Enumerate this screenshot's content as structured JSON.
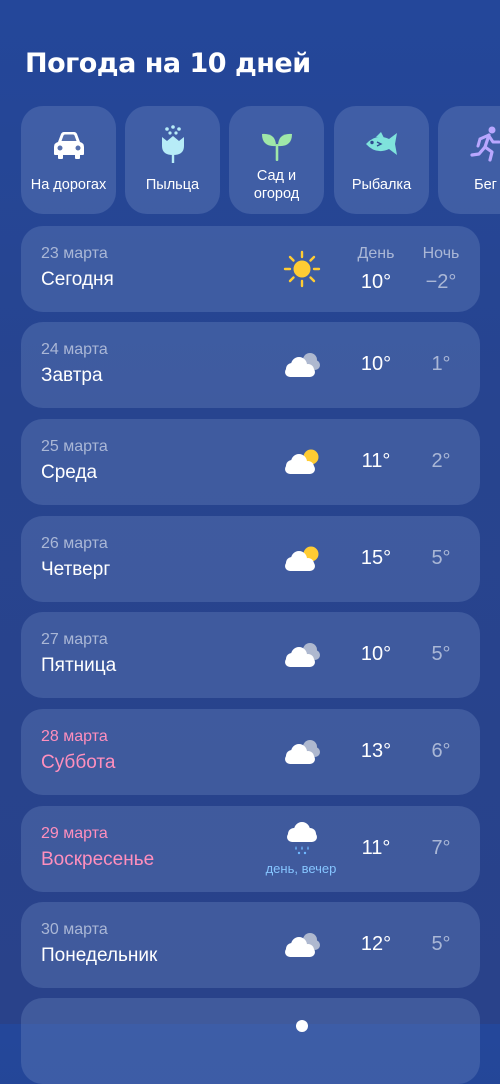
{
  "page_title": "Погода на 10 дней",
  "categories": [
    {
      "label": "На дорогах",
      "icon": "car-icon",
      "color": "#ffffff"
    },
    {
      "label": "Пыльца",
      "icon": "flower-icon",
      "color": "#b7ecf7"
    },
    {
      "label": "Сад и\nогород",
      "icon": "sprout-icon",
      "color": "#9fe7a8"
    },
    {
      "label": "Рыбалка",
      "icon": "fish-icon",
      "color": "#7fe3dc"
    },
    {
      "label": "Бег",
      "icon": "runner-icon",
      "color": "#b9a7ff"
    }
  ],
  "headers": {
    "day": "День",
    "night": "Ночь"
  },
  "forecast": [
    {
      "date": "23 марта",
      "weekday": "Сегодня",
      "icon": "sun-icon",
      "day_temp": "10°",
      "night_temp": "−2°",
      "weekend": false,
      "note": ""
    },
    {
      "date": "24 марта",
      "weekday": "Завтра",
      "icon": "cloudy-icon",
      "day_temp": "10°",
      "night_temp": "1°",
      "weekend": false,
      "note": ""
    },
    {
      "date": "25 марта",
      "weekday": "Среда",
      "icon": "partly-cloudy-icon",
      "day_temp": "11°",
      "night_temp": "2°",
      "weekend": false,
      "note": ""
    },
    {
      "date": "26 марта",
      "weekday": "Четверг",
      "icon": "partly-cloudy-icon",
      "day_temp": "15°",
      "night_temp": "5°",
      "weekend": false,
      "note": ""
    },
    {
      "date": "27 марта",
      "weekday": "Пятница",
      "icon": "cloudy-icon",
      "day_temp": "10°",
      "night_temp": "5°",
      "weekend": false,
      "note": ""
    },
    {
      "date": "28 марта",
      "weekday": "Суббота",
      "icon": "cloudy-icon",
      "day_temp": "13°",
      "night_temp": "6°",
      "weekend": true,
      "note": ""
    },
    {
      "date": "29 марта",
      "weekday": "Воскресенье",
      "icon": "rain-icon",
      "day_temp": "11°",
      "night_temp": "7°",
      "weekend": true,
      "note": "день, вечер"
    },
    {
      "date": "30 марта",
      "weekday": "Понедельник",
      "icon": "cloudy-icon",
      "day_temp": "12°",
      "night_temp": "5°",
      "weekend": false,
      "note": ""
    }
  ],
  "colors": {
    "weekend": "#ff8fbd",
    "secondary_text": "#aab7d6",
    "sun": "#ffcc33",
    "precipitation_note": "#86c5ff"
  }
}
